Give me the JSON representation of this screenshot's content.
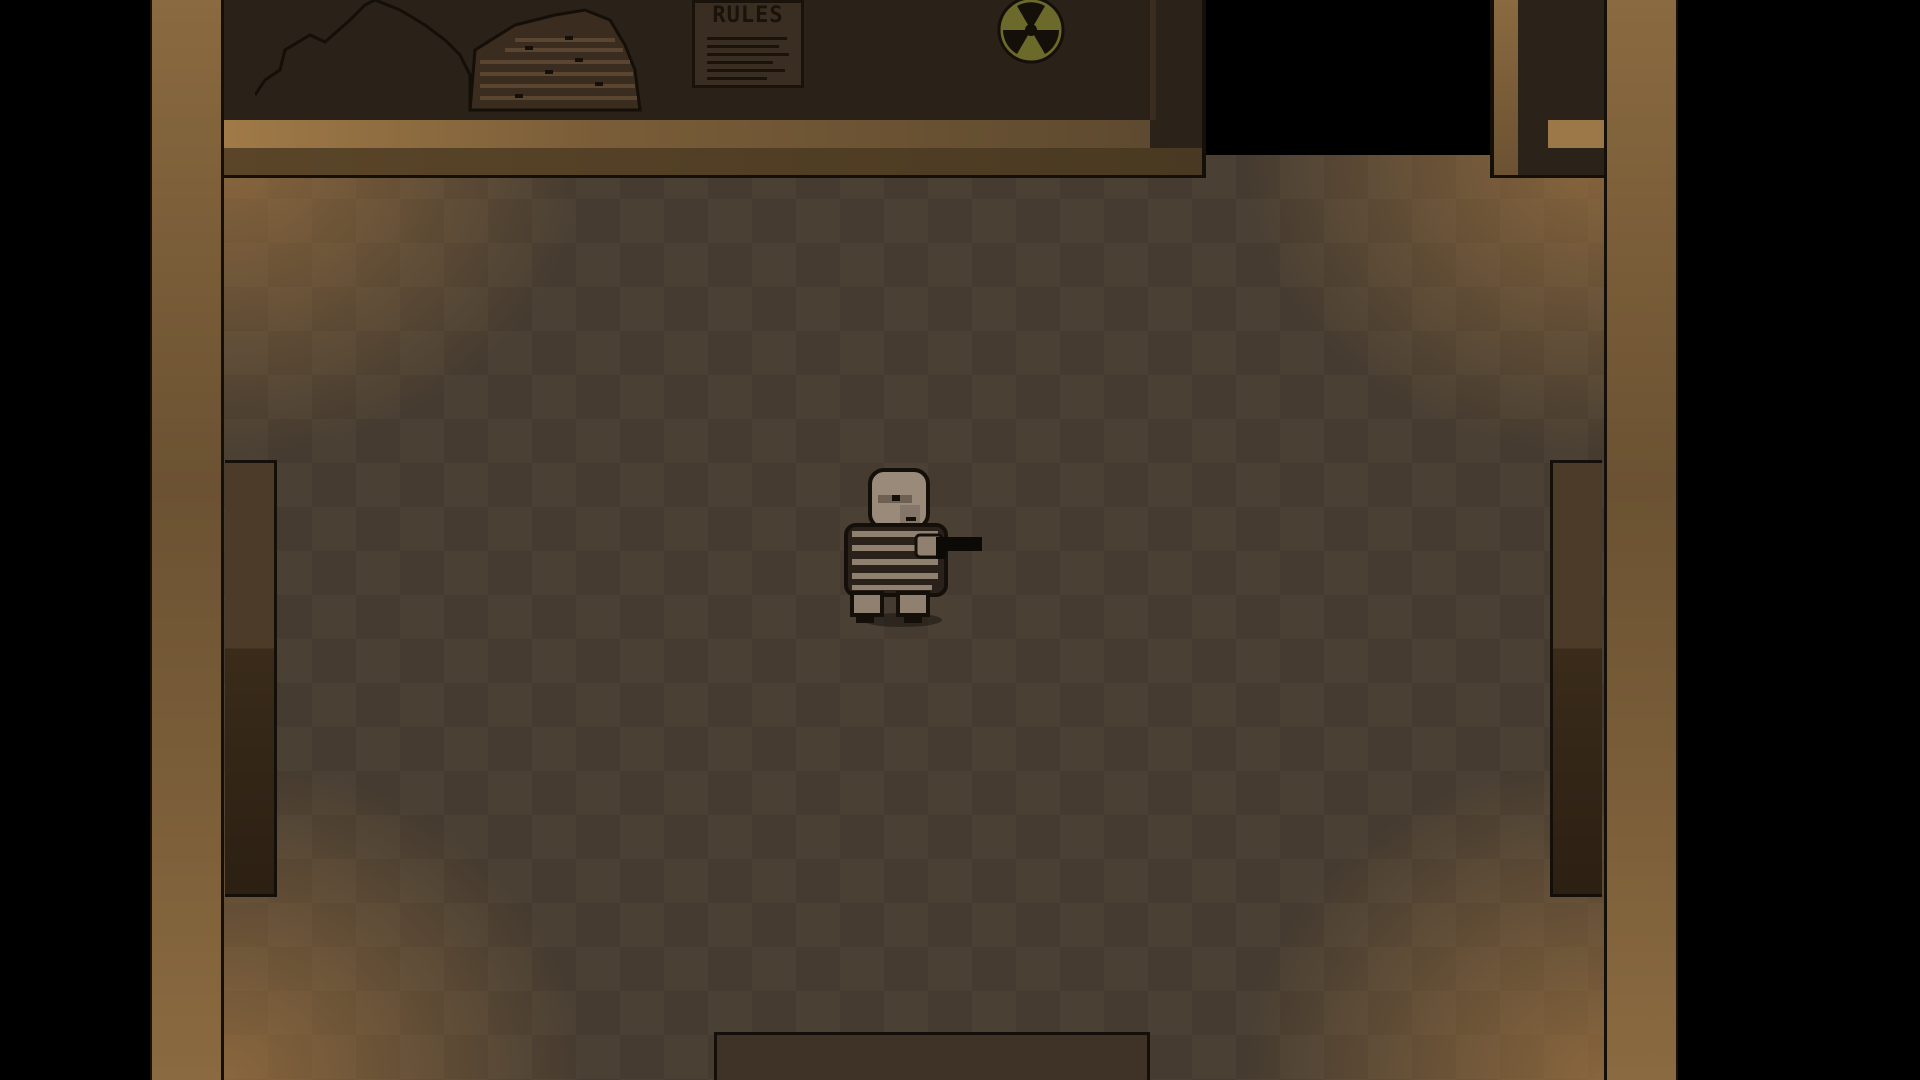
{
  "scene": {
    "type": "top-down pixel room",
    "floor_color": "#4a4034",
    "wall_color": "#8a6a40",
    "light_color": "#be8746"
  },
  "wall_decor": {
    "poster": {
      "title": "RULES"
    },
    "radiation_sign": {
      "icon": "radiation-icon",
      "color": "#6b6a2a"
    }
  },
  "player": {
    "sprite": "prisoner-sprite",
    "outfit": "striped",
    "holding": "pistol",
    "facing": "right"
  }
}
